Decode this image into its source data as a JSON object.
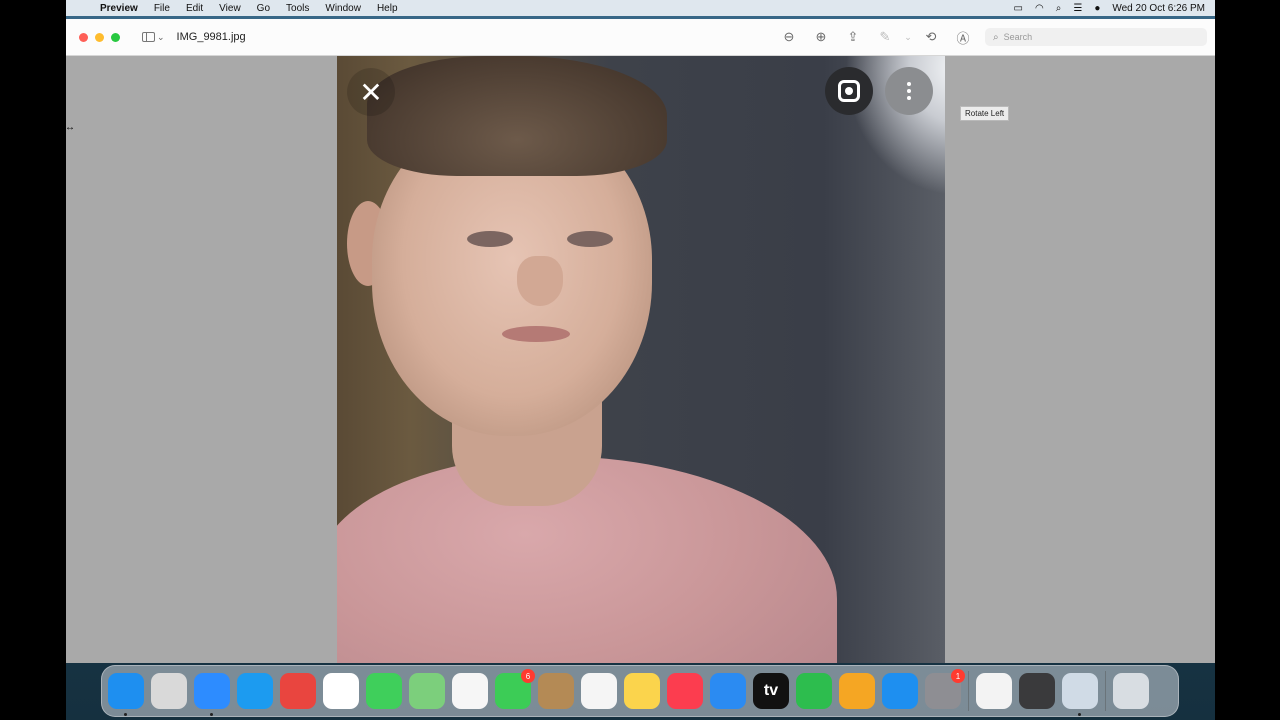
{
  "menubar": {
    "apple_icon": "apple-logo-icon",
    "app_name": "Preview",
    "items": [
      "File",
      "Edit",
      "View",
      "Go",
      "Tools",
      "Window",
      "Help"
    ],
    "status_icons": [
      "battery-icon",
      "wifi-icon",
      "spotlight-icon",
      "control-center-icon",
      "siri-icon"
    ],
    "datetime": "Wed 20 Oct  6:26 PM"
  },
  "window": {
    "title": "IMG_9981.jpg",
    "toolbar": {
      "zoom_out_icon": "zoom-out-icon",
      "zoom_in_icon": "zoom-in-icon",
      "share_icon": "share-icon",
      "markup_icon": "highlight-pen-icon",
      "rotate_icon": "rotate-icon",
      "annotate_icon": "markup-icon"
    },
    "search_placeholder": "Search",
    "tooltip": "Rotate Left"
  },
  "image_overlay": {
    "close_symbol": "✕",
    "lens_icon": "google-lens-icon",
    "more_icon": "more-vertical-icon"
  },
  "dock": {
    "apps": [
      {
        "name": "Finder",
        "icon": "finder-icon",
        "color": "#1e8ff0",
        "running": true
      },
      {
        "name": "Launchpad",
        "icon": "launchpad-icon",
        "color": "#d9d9d9"
      },
      {
        "name": "Zoom",
        "icon": "zoom-icon",
        "color": "#2d8cff",
        "running": true
      },
      {
        "name": "Safari",
        "icon": "safari-icon",
        "color": "#1c9bf0"
      },
      {
        "name": "Mail",
        "icon": "mail-icon",
        "color": "#e9453f"
      },
      {
        "name": "Chrome",
        "icon": "chrome-icon",
        "color": "#ffffff"
      },
      {
        "name": "Messages",
        "icon": "messages-icon",
        "color": "#3fcf5b"
      },
      {
        "name": "Maps",
        "icon": "maps-icon",
        "color": "#7ccf7c"
      },
      {
        "name": "Photos",
        "icon": "photos-icon",
        "color": "#f6f6f6"
      },
      {
        "name": "FaceTime",
        "icon": "facetime-icon",
        "color": "#3ccc56",
        "badge": "6"
      },
      {
        "name": "Contacts",
        "icon": "contacts-icon",
        "color": "#b48a55"
      },
      {
        "name": "Reminders",
        "icon": "reminders-icon",
        "color": "#f5f5f5"
      },
      {
        "name": "Notes",
        "icon": "notes-icon",
        "color": "#fbd44c"
      },
      {
        "name": "Music",
        "icon": "music-icon",
        "color": "#fc3d4f"
      },
      {
        "name": "Keynote",
        "icon": "keynote-icon",
        "color": "#2b8bf2"
      },
      {
        "name": "TV",
        "icon": "apple-tv-icon",
        "color": "#111111",
        "label": "tv"
      },
      {
        "name": "Numbers",
        "icon": "numbers-icon",
        "color": "#2dbd4e"
      },
      {
        "name": "Pages",
        "icon": "pages-icon",
        "color": "#f5a623"
      },
      {
        "name": "App Store",
        "icon": "app-store-icon",
        "color": "#1e8ff0"
      },
      {
        "name": "System Preferences",
        "icon": "system-preferences-icon",
        "color": "#8e8e93",
        "badge": "1"
      }
    ],
    "recent": [
      {
        "name": "TextEdit",
        "icon": "textedit-icon",
        "color": "#f3f3f3"
      },
      {
        "name": "QuickTime Player",
        "icon": "quicktime-icon",
        "color": "#3a3a3c"
      },
      {
        "name": "Preview",
        "icon": "preview-icon",
        "color": "#d0dbe6",
        "running": true
      }
    ],
    "trash": {
      "name": "Trash",
      "icon": "trash-icon",
      "color": "#d8dde2"
    }
  }
}
